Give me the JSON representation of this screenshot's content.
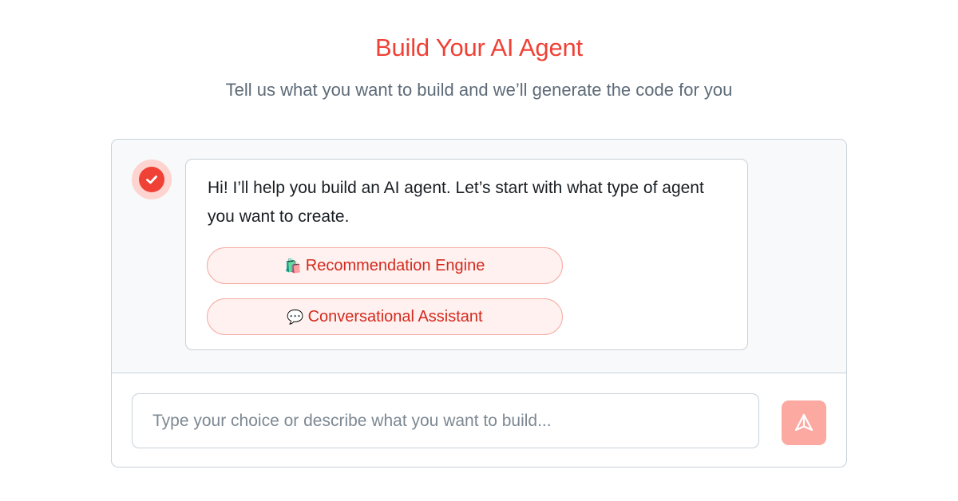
{
  "header": {
    "title": "Build Your AI Agent",
    "subtitle": "Tell us what you want to build and we’ll generate the code for you"
  },
  "chat": {
    "assistant_icon": "check-circle-icon",
    "message": "Hi! I’ll help you build an AI agent. Let’s start with what type of agent you want to create.",
    "options": [
      {
        "emoji": "🛍️",
        "icon": "shopping-bags-icon",
        "label": "Recommendation Engine"
      },
      {
        "emoji": "💬",
        "icon": "speech-bubble-icon",
        "label": "Conversational Assistant"
      }
    ]
  },
  "composer": {
    "placeholder": "Type your choice or describe what you want to build...",
    "value": "",
    "send_icon": "send-icon"
  },
  "colors": {
    "accent": "#ef4135",
    "accent_soft": "#fef1ef",
    "accent_border": "#f7a9a1",
    "send_button": "#fba9a1",
    "subtitle": "#5e6b78",
    "panel_border": "#c9d1d8",
    "chat_background": "#f7f9fa"
  }
}
